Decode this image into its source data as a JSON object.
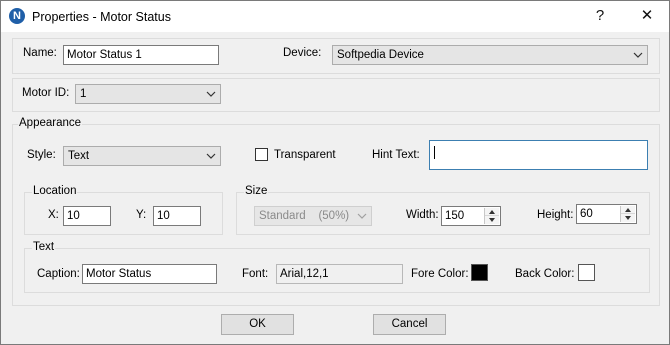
{
  "window": {
    "title": "Properties - Motor Status",
    "icon_letter": "N",
    "help_glyph": "?",
    "close_glyph": "✕"
  },
  "name": {
    "label": "Name:",
    "value": "Motor Status 1"
  },
  "device": {
    "label": "Device:",
    "value": "Softpedia Device"
  },
  "motor": {
    "label": "Motor ID:",
    "value": "1"
  },
  "appearance": {
    "group_label": "Appearance",
    "style_label": "Style:",
    "style_value": "Text",
    "transparent_label": "Transparent",
    "transparent_checked": false,
    "hint_label": "Hint Text:",
    "hint_value": ""
  },
  "location": {
    "group_label": "Location",
    "x_label": "X:",
    "x_value": "10",
    "y_label": "Y:",
    "y_value": "10"
  },
  "size": {
    "group_label": "Size",
    "preset_value": "Standard    (50%)",
    "width_label": "Width:",
    "width_value": "150",
    "height_label": "Height:",
    "height_value": "60"
  },
  "text": {
    "group_label": "Text",
    "caption_label": "Caption:",
    "caption_value": "Motor Status",
    "font_label": "Font:",
    "font_value": "Arial,12,1",
    "fore_label": "Fore Color:",
    "fore_color": "#000000",
    "back_label": "Back Color:",
    "back_color": "#ffffff"
  },
  "buttons": {
    "ok": "OK",
    "cancel": "Cancel"
  }
}
